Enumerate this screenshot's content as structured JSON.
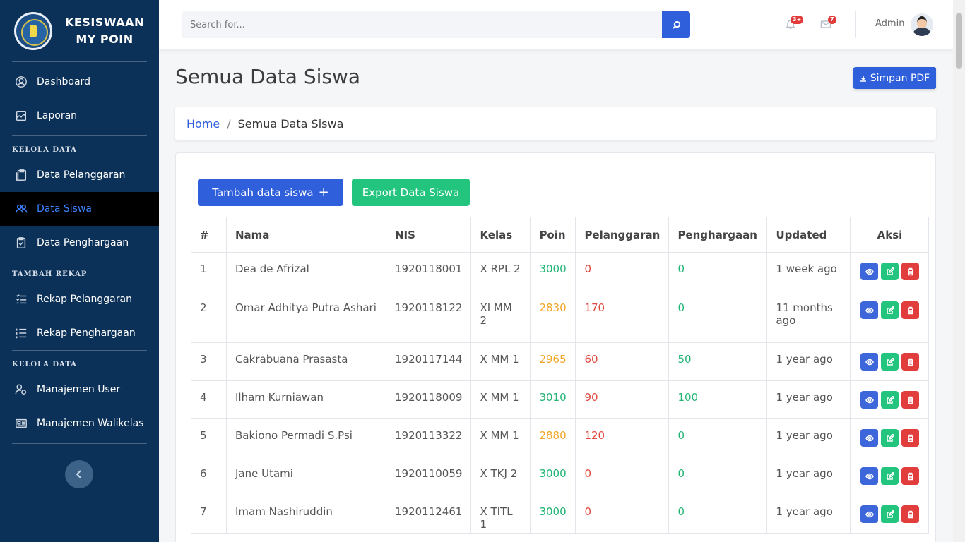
{
  "sidebar": {
    "brand_line1": "KESISWAAN",
    "brand_line2": "MY POIN",
    "items": [
      {
        "label": "Dashboard",
        "icon": "user-circle-icon"
      },
      {
        "label": "Laporan",
        "icon": "chart-icon"
      }
    ],
    "section1": "KELOLA DATA",
    "items2": [
      {
        "label": "Data Pelanggaran",
        "icon": "clipboard-icon"
      },
      {
        "label": "Data Siswa",
        "icon": "users-icon",
        "active": true
      },
      {
        "label": "Data Penghargaan",
        "icon": "clipboard-check-icon"
      }
    ],
    "section2": "TAMBAH REKAP",
    "items3": [
      {
        "label": "Rekap Pelanggaran",
        "icon": "list-check-icon"
      },
      {
        "label": "Rekap Penghargaan",
        "icon": "list-icon"
      }
    ],
    "section3": "KELOLA DATA",
    "items4": [
      {
        "label": "Manajemen User",
        "icon": "user-settings-icon"
      },
      {
        "label": "Manajemen Walikelas",
        "icon": "id-card-icon"
      }
    ]
  },
  "topbar": {
    "search_placeholder": "Search for...",
    "notif_badge": "3+",
    "mail_badge": "7",
    "user_name": "Admin"
  },
  "main": {
    "title": "Semua Data Siswa",
    "pdf_button": "Simpan PDF",
    "breadcrumb_home": "Home",
    "breadcrumb_current": "Semua Data Siswa",
    "add_button": "Tambah data siswa",
    "export_button": "Export Data Siswa"
  },
  "table": {
    "headers": [
      "#",
      "Nama",
      "NIS",
      "Kelas",
      "Poin",
      "Pelanggaran",
      "Penghargaan",
      "Updated",
      "Aksi"
    ],
    "rows": [
      {
        "no": "1",
        "nama": "Dea de Afrizal",
        "nis": "1920118001",
        "kelas": "X RPL 2",
        "poin": "3000",
        "pelanggaran": "0",
        "penghargaan": "0",
        "updated": "1 week ago"
      },
      {
        "no": "2",
        "nama": "Omar Adhitya Putra Ashari",
        "nis": "1920118122",
        "kelas": "XI MM 2",
        "poin": "2830",
        "pelanggaran": "170",
        "penghargaan": "0",
        "updated": "11 months ago"
      },
      {
        "no": "3",
        "nama": "Cakrabuana Prasasta",
        "nis": "1920117144",
        "kelas": "X MM 1",
        "poin": "2965",
        "pelanggaran": "60",
        "penghargaan": "50",
        "updated": "1 year ago"
      },
      {
        "no": "4",
        "nama": "Ilham Kurniawan",
        "nis": "1920118009",
        "kelas": "X MM 1",
        "poin": "3010",
        "pelanggaran": "90",
        "penghargaan": "100",
        "updated": "1 year ago"
      },
      {
        "no": "5",
        "nama": "Bakiono Permadi S.Psi",
        "nis": "1920113322",
        "kelas": "X MM 1",
        "poin": "2880",
        "pelanggaran": "120",
        "penghargaan": "0",
        "updated": "1 year ago"
      },
      {
        "no": "6",
        "nama": "Jane Utami",
        "nis": "1920110059",
        "kelas": "X TKJ 2",
        "poin": "3000",
        "pelanggaran": "0",
        "penghargaan": "0",
        "updated": "1 year ago"
      },
      {
        "no": "7",
        "nama": "Imam Nashiruddin",
        "nis": "1920112461",
        "kelas": "X TITL 1",
        "poin": "3000",
        "pelanggaran": "0",
        "penghargaan": "0",
        "updated": "1 year ago"
      }
    ]
  },
  "colors": {
    "sidebar_bg": "#0c3158",
    "primary": "#2f5fdb",
    "success": "#22c47e",
    "danger": "#e23d3d",
    "warning": "#f2a628"
  }
}
